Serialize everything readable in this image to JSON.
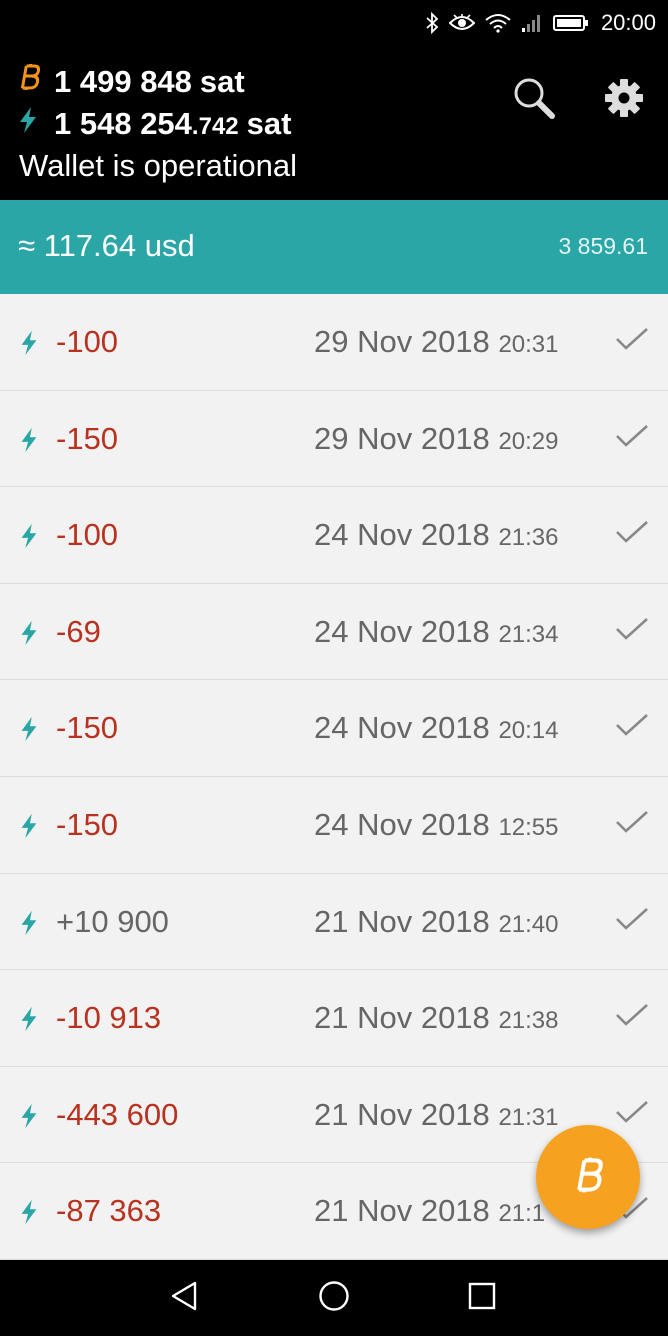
{
  "status_bar": {
    "time": "20:00",
    "icons": [
      "bluetooth-icon",
      "eye-icon",
      "wifi-icon",
      "signal-icon",
      "battery-icon"
    ]
  },
  "header": {
    "btc_balance": "1 499 848",
    "btc_unit": "sat",
    "ln_balance_main": "1 548 254",
    "ln_balance_frac": ".742",
    "ln_unit": "sat",
    "status": "Wallet is operational",
    "actions": [
      "search-icon",
      "settings-gear-icon"
    ]
  },
  "fiat": {
    "value": "≈ 117.64 usd",
    "rate": "3 859.61"
  },
  "colors": {
    "accent_teal": "#2aa6a6",
    "btc_orange": "#f7931a",
    "negative_red": "#b8321f",
    "fab_orange": "#f7a121"
  },
  "transactions": [
    {
      "amount": "-100",
      "date": "29 Nov 2018",
      "time": "20:31",
      "type": "negative"
    },
    {
      "amount": "-150",
      "date": "29 Nov 2018",
      "time": "20:29",
      "type": "negative"
    },
    {
      "amount": "-100",
      "date": "24 Nov 2018",
      "time": "21:36",
      "type": "negative"
    },
    {
      "amount": "-69",
      "date": "24 Nov 2018",
      "time": "21:34",
      "type": "negative"
    },
    {
      "amount": "-150",
      "date": "24 Nov 2018",
      "time": "20:14",
      "type": "negative"
    },
    {
      "amount": "-150",
      "date": "24 Nov 2018",
      "time": "12:55",
      "type": "negative"
    },
    {
      "amount": "+10 900",
      "date": "21 Nov 2018",
      "time": "21:40",
      "type": "positive"
    },
    {
      "amount": "-10 913",
      "date": "21 Nov 2018",
      "time": "21:38",
      "type": "negative"
    },
    {
      "amount": "-443 600",
      "date": "21 Nov 2018",
      "time": "21:31",
      "type": "negative"
    },
    {
      "amount": "-87 363",
      "date": "21 Nov 2018",
      "time": "21:1",
      "type": "negative"
    }
  ],
  "fab": {
    "icon": "bitcoin-icon"
  },
  "nav": [
    "back-icon",
    "home-icon",
    "recent-apps-icon"
  ]
}
